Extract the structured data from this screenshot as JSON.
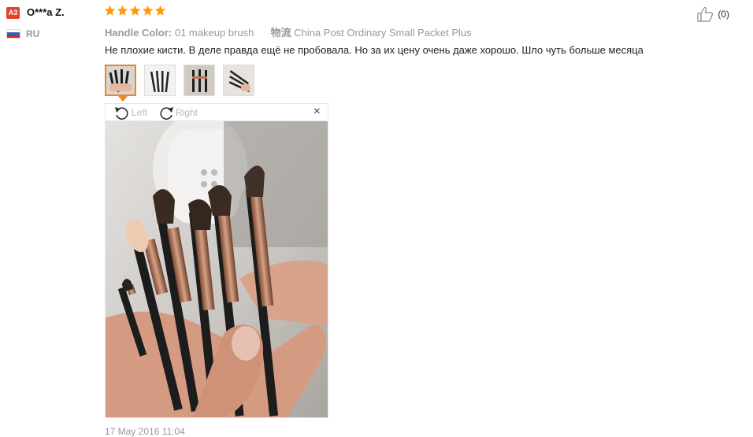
{
  "reviewer": {
    "level_badge": "A3",
    "name": "O***a Z.",
    "country": "RU",
    "flag": "russia-flag"
  },
  "rating": {
    "stars": 5,
    "max": 5
  },
  "meta": {
    "color_label": "Handle Color:",
    "color_value": "01 makeup brush",
    "shipping_label": "物流",
    "shipping_value": "China Post Ordinary Small Packet Plus"
  },
  "review_text": "Не плохие кисти. В деле правда ещё не пробовала. Но за их цену очень даже хорошо. Шло чуть больше месяца",
  "helpful": {
    "count": "(0)",
    "icon": "thumbs-up-icon"
  },
  "images": {
    "thumbnail_count": 4,
    "active_index": 0
  },
  "viewer": {
    "rotate_left_label": "Left",
    "rotate_right_label": "Right",
    "close_label": "×"
  },
  "date": "17 May 2016 11:04",
  "colors": {
    "accent": "#e8862a",
    "star": "#ff9a00",
    "badge": "#e5412d",
    "handle": "#1c1c1c",
    "ferrule": "#b57a5a"
  }
}
